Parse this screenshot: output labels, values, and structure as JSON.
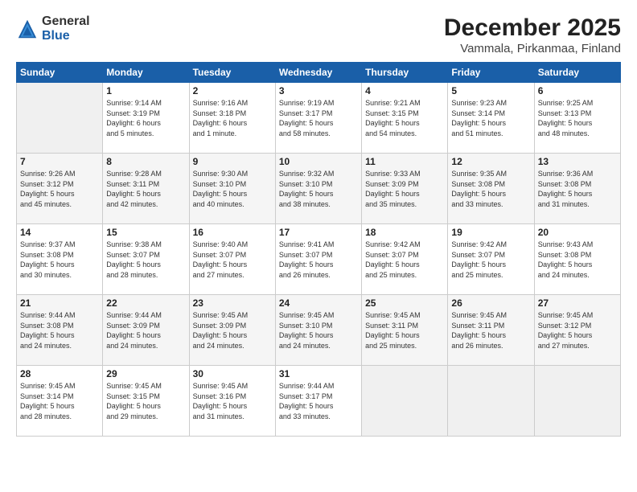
{
  "logo": {
    "general": "General",
    "blue": "Blue"
  },
  "title": {
    "month": "December 2025",
    "location": "Vammala, Pirkanmaa, Finland"
  },
  "weekdays": [
    "Sunday",
    "Monday",
    "Tuesday",
    "Wednesday",
    "Thursday",
    "Friday",
    "Saturday"
  ],
  "weeks": [
    [
      {
        "day": "",
        "info": ""
      },
      {
        "day": "1",
        "info": "Sunrise: 9:14 AM\nSunset: 3:19 PM\nDaylight: 6 hours\nand 5 minutes."
      },
      {
        "day": "2",
        "info": "Sunrise: 9:16 AM\nSunset: 3:18 PM\nDaylight: 6 hours\nand 1 minute."
      },
      {
        "day": "3",
        "info": "Sunrise: 9:19 AM\nSunset: 3:17 PM\nDaylight: 5 hours\nand 58 minutes."
      },
      {
        "day": "4",
        "info": "Sunrise: 9:21 AM\nSunset: 3:15 PM\nDaylight: 5 hours\nand 54 minutes."
      },
      {
        "day": "5",
        "info": "Sunrise: 9:23 AM\nSunset: 3:14 PM\nDaylight: 5 hours\nand 51 minutes."
      },
      {
        "day": "6",
        "info": "Sunrise: 9:25 AM\nSunset: 3:13 PM\nDaylight: 5 hours\nand 48 minutes."
      }
    ],
    [
      {
        "day": "7",
        "info": "Sunrise: 9:26 AM\nSunset: 3:12 PM\nDaylight: 5 hours\nand 45 minutes."
      },
      {
        "day": "8",
        "info": "Sunrise: 9:28 AM\nSunset: 3:11 PM\nDaylight: 5 hours\nand 42 minutes."
      },
      {
        "day": "9",
        "info": "Sunrise: 9:30 AM\nSunset: 3:10 PM\nDaylight: 5 hours\nand 40 minutes."
      },
      {
        "day": "10",
        "info": "Sunrise: 9:32 AM\nSunset: 3:10 PM\nDaylight: 5 hours\nand 38 minutes."
      },
      {
        "day": "11",
        "info": "Sunrise: 9:33 AM\nSunset: 3:09 PM\nDaylight: 5 hours\nand 35 minutes."
      },
      {
        "day": "12",
        "info": "Sunrise: 9:35 AM\nSunset: 3:08 PM\nDaylight: 5 hours\nand 33 minutes."
      },
      {
        "day": "13",
        "info": "Sunrise: 9:36 AM\nSunset: 3:08 PM\nDaylight: 5 hours\nand 31 minutes."
      }
    ],
    [
      {
        "day": "14",
        "info": "Sunrise: 9:37 AM\nSunset: 3:08 PM\nDaylight: 5 hours\nand 30 minutes."
      },
      {
        "day": "15",
        "info": "Sunrise: 9:38 AM\nSunset: 3:07 PM\nDaylight: 5 hours\nand 28 minutes."
      },
      {
        "day": "16",
        "info": "Sunrise: 9:40 AM\nSunset: 3:07 PM\nDaylight: 5 hours\nand 27 minutes."
      },
      {
        "day": "17",
        "info": "Sunrise: 9:41 AM\nSunset: 3:07 PM\nDaylight: 5 hours\nand 26 minutes."
      },
      {
        "day": "18",
        "info": "Sunrise: 9:42 AM\nSunset: 3:07 PM\nDaylight: 5 hours\nand 25 minutes."
      },
      {
        "day": "19",
        "info": "Sunrise: 9:42 AM\nSunset: 3:07 PM\nDaylight: 5 hours\nand 25 minutes."
      },
      {
        "day": "20",
        "info": "Sunrise: 9:43 AM\nSunset: 3:08 PM\nDaylight: 5 hours\nand 24 minutes."
      }
    ],
    [
      {
        "day": "21",
        "info": "Sunrise: 9:44 AM\nSunset: 3:08 PM\nDaylight: 5 hours\nand 24 minutes."
      },
      {
        "day": "22",
        "info": "Sunrise: 9:44 AM\nSunset: 3:09 PM\nDaylight: 5 hours\nand 24 minutes."
      },
      {
        "day": "23",
        "info": "Sunrise: 9:45 AM\nSunset: 3:09 PM\nDaylight: 5 hours\nand 24 minutes."
      },
      {
        "day": "24",
        "info": "Sunrise: 9:45 AM\nSunset: 3:10 PM\nDaylight: 5 hours\nand 24 minutes."
      },
      {
        "day": "25",
        "info": "Sunrise: 9:45 AM\nSunset: 3:11 PM\nDaylight: 5 hours\nand 25 minutes."
      },
      {
        "day": "26",
        "info": "Sunrise: 9:45 AM\nSunset: 3:11 PM\nDaylight: 5 hours\nand 26 minutes."
      },
      {
        "day": "27",
        "info": "Sunrise: 9:45 AM\nSunset: 3:12 PM\nDaylight: 5 hours\nand 27 minutes."
      }
    ],
    [
      {
        "day": "28",
        "info": "Sunrise: 9:45 AM\nSunset: 3:14 PM\nDaylight: 5 hours\nand 28 minutes."
      },
      {
        "day": "29",
        "info": "Sunrise: 9:45 AM\nSunset: 3:15 PM\nDaylight: 5 hours\nand 29 minutes."
      },
      {
        "day": "30",
        "info": "Sunrise: 9:45 AM\nSunset: 3:16 PM\nDaylight: 5 hours\nand 31 minutes."
      },
      {
        "day": "31",
        "info": "Sunrise: 9:44 AM\nSunset: 3:17 PM\nDaylight: 5 hours\nand 33 minutes."
      },
      {
        "day": "",
        "info": ""
      },
      {
        "day": "",
        "info": ""
      },
      {
        "day": "",
        "info": ""
      }
    ]
  ]
}
